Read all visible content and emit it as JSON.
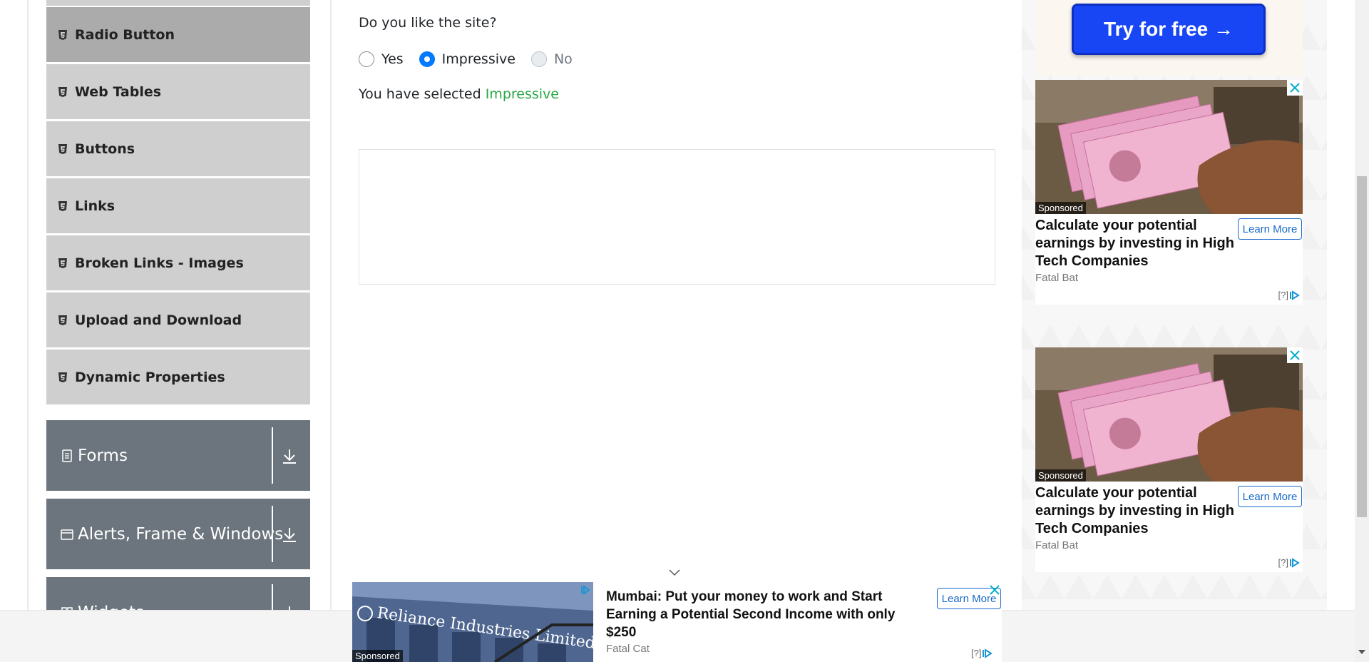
{
  "sidebar": {
    "items": [
      {
        "label": "Radio Button",
        "active": true
      },
      {
        "label": "Web Tables",
        "active": false
      },
      {
        "label": "Buttons",
        "active": false
      },
      {
        "label": "Links",
        "active": false
      },
      {
        "label": "Broken Links - Images",
        "active": false
      },
      {
        "label": "Upload and Download",
        "active": false
      },
      {
        "label": "Dynamic Properties",
        "active": false
      }
    ],
    "groups": [
      {
        "label": "Forms",
        "icon": "document-icon"
      },
      {
        "label": "Alerts, Frame & Windows",
        "icon": "window-icon"
      },
      {
        "label": "Widgets",
        "icon": "widget-icon"
      }
    ]
  },
  "main": {
    "question": "Do you like the site?",
    "options": [
      {
        "label": "Yes",
        "checked": false,
        "disabled": false
      },
      {
        "label": "Impressive",
        "checked": true,
        "disabled": false
      },
      {
        "label": "No",
        "checked": false,
        "disabled": true
      }
    ],
    "result_prefix": "You have selected ",
    "result_value": "Impressive"
  },
  "ads": {
    "try_button": "Try for free →",
    "cards": [
      {
        "sponsored": "Sponsored",
        "title": "Calculate your potential earnings by investing in High Tech Companies",
        "source": "Fatal Bat",
        "cta": "Learn More",
        "choice": "[?]"
      },
      {
        "sponsored": "Sponsored",
        "title": "Calculate your potential earnings by investing in High Tech Companies",
        "source": "Fatal Bat",
        "cta": "Learn More",
        "choice": "[?]"
      }
    ],
    "bottom": {
      "sponsored": "Sponsored",
      "image_text": "Reliance Industries Limited",
      "title": "Mumbai: Put your money to work and Start Earning a Potential Second Income with only $250",
      "source": "Fatal Cat",
      "cta": "Learn More",
      "choice": "[?]"
    }
  },
  "colors": {
    "accent": "#007bff",
    "success": "#28a745",
    "group_bg": "#6c757d",
    "try_button": "#1846f5"
  }
}
